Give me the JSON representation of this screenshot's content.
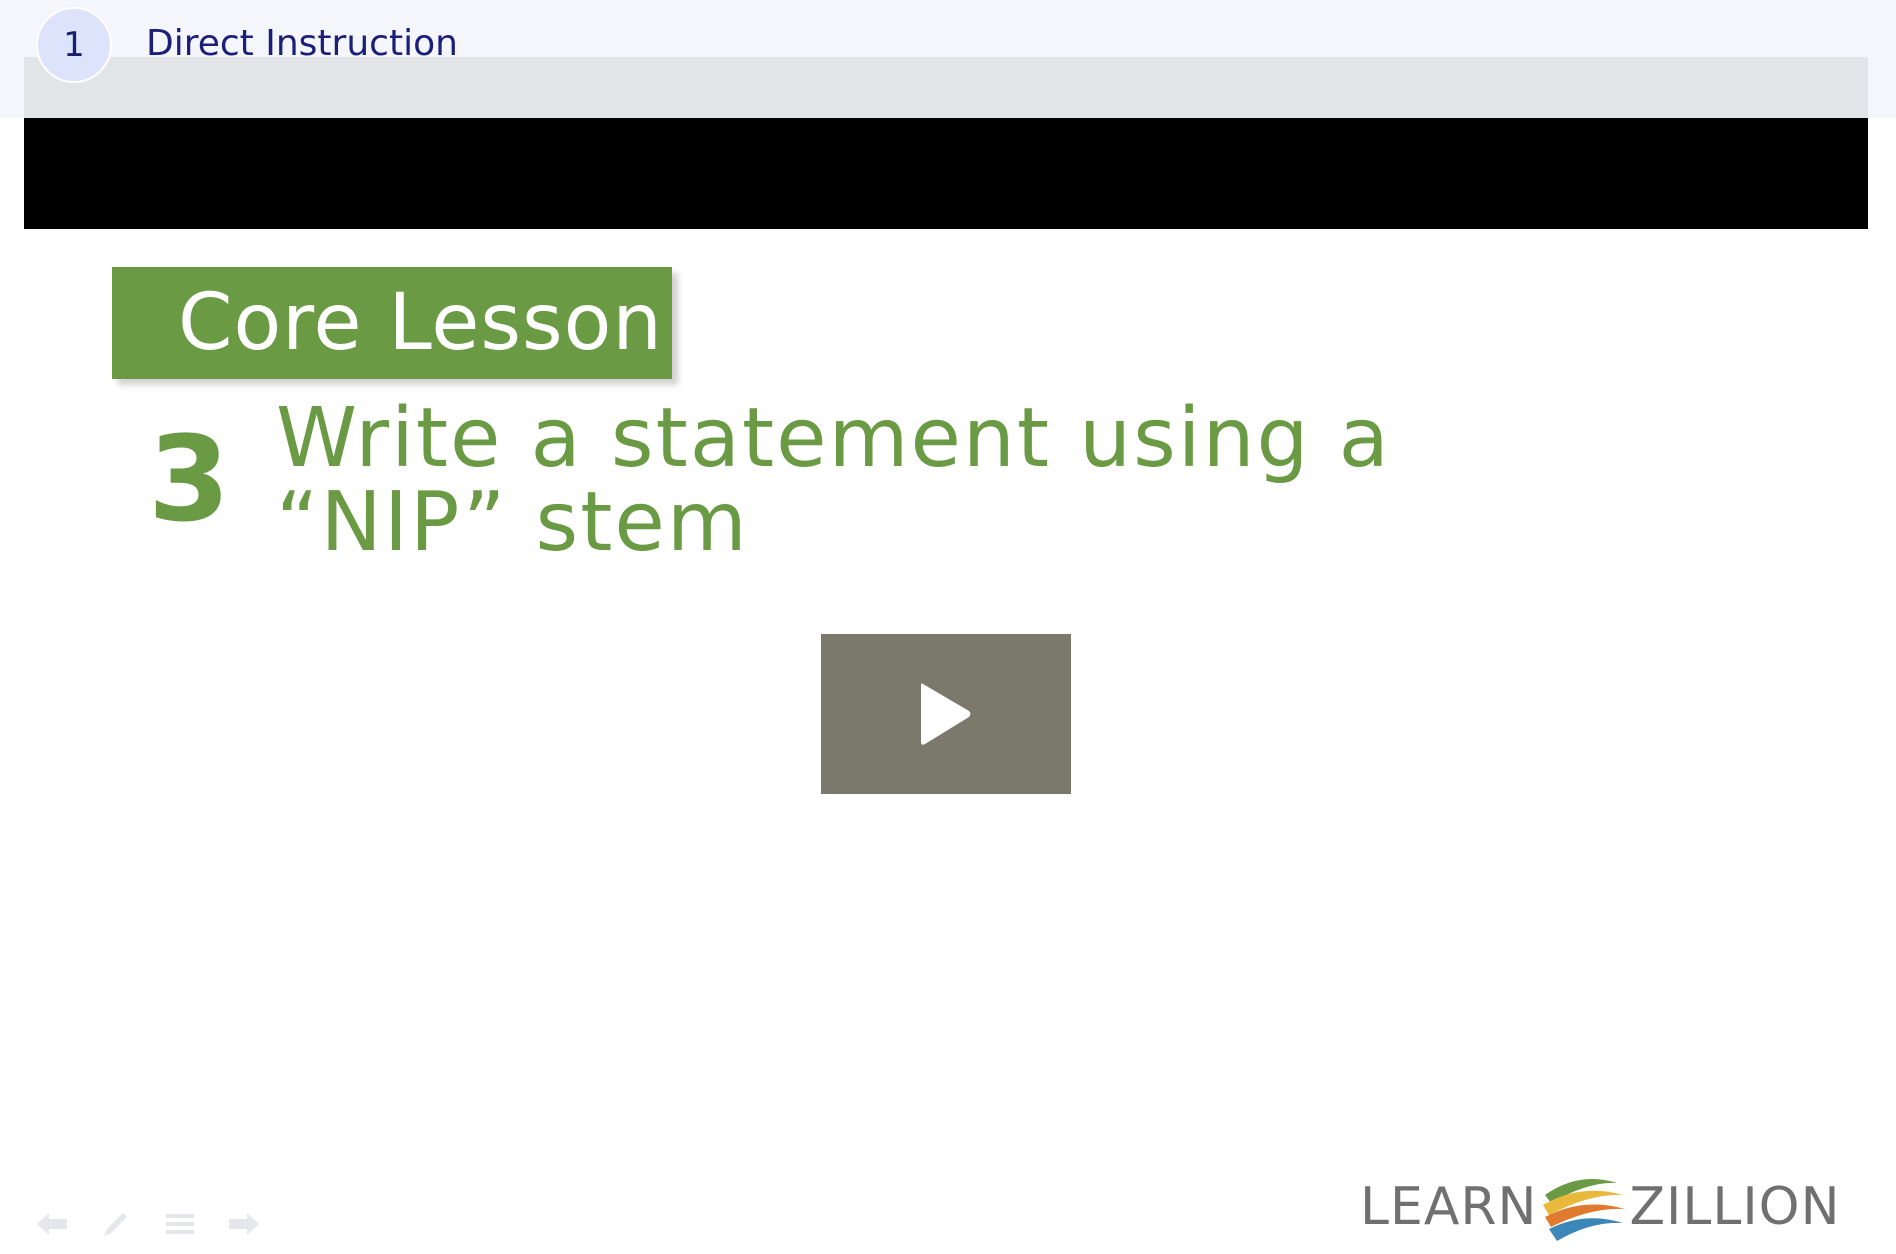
{
  "header": {
    "step_number": "1",
    "section_title": "Direct Instruction"
  },
  "video": {
    "slide": {
      "tag": "Core Lesson",
      "step_number": "3",
      "step_text": "Write a statement using a “NIP” stem"
    },
    "play_icon": "play-icon",
    "controls": [
      "back-arrow-icon",
      "pen-icon",
      "menu-lines-icon",
      "forward-arrow-icon"
    ]
  },
  "logo": {
    "left": "LEARN",
    "right": "ZILLION"
  },
  "colors": {
    "header_bg": "#f4f6fb",
    "title_text": "#1b1f7a",
    "lesson_green": "#6a9a43",
    "play_button": "#7b796b"
  }
}
